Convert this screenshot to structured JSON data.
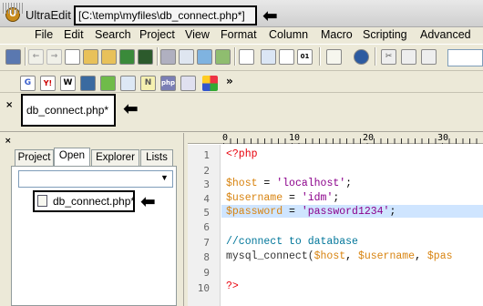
{
  "titlebar": {
    "app_name": "UltraEdit - ",
    "path": "[C:\\temp\\myfiles\\db_connect.php*]"
  },
  "menubar": {
    "items": [
      "File",
      "Edit",
      "Search",
      "Project",
      "View",
      "Format",
      "Column",
      "Macro",
      "Scripting",
      "Advanced"
    ]
  },
  "toolbar2": {
    "more": "»",
    "php_label": "php",
    "w_label": "W",
    "g_label": "G",
    "n_label": "N"
  },
  "tabbar": {
    "tab_label": "db_connect.php*",
    "close": "×"
  },
  "left_panel": {
    "close": "×",
    "tabs": [
      "Project",
      "Open",
      "Explorer",
      "Lists"
    ],
    "active_tab": "Open",
    "files": [
      "db_connect.php*"
    ]
  },
  "editor": {
    "ruler": [
      "0",
      "10",
      "20",
      "30"
    ],
    "line_numbers": [
      "1",
      "2",
      "3",
      "4",
      "5",
      "6",
      "7",
      "8",
      "9",
      "10"
    ],
    "highlighted_line": 5,
    "code": {
      "l1": "<?php",
      "l3_var": "$host",
      "l3_rest": " = ",
      "l3_str": "'localhost'",
      "l3_end": ";",
      "l4_var": "$username",
      "l4_rest": " = ",
      "l4_str": "'idm'",
      "l4_end": ";",
      "l5_var": "$password",
      "l5_rest": " = ",
      "l5_str": "'password1234'",
      "l5_end": ";",
      "l7": "//connect to database",
      "l8_fn": "mysql_connect(",
      "l8_v1": "$host",
      "l8_c1": ", ",
      "l8_v2": "$username",
      "l8_c2": ", ",
      "l8_v3": "$pas",
      "l10": "?>"
    }
  }
}
